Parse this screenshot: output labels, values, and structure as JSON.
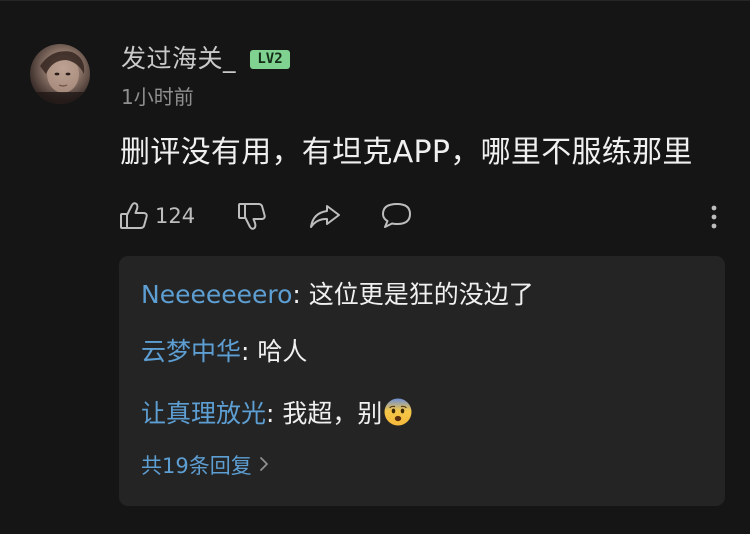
{
  "comment": {
    "username": "发过海关_",
    "level_badge": "LV2",
    "timestamp": "1小时前",
    "text": "删评没有用，有坦克APP，哪里不服练那里",
    "like_count": "124"
  },
  "icons": {
    "like": "thumbs-up-icon",
    "dislike": "thumbs-down-icon",
    "share": "share-icon",
    "reply": "comment-icon",
    "more": "more-vertical-icon",
    "chevron": "chevron-right-icon"
  },
  "replies": {
    "items": [
      {
        "author": "Neeeeeeero",
        "separator": ": ",
        "text": "这位更是狂的没边了"
      },
      {
        "author": "云梦中华",
        "separator": ": ",
        "text": "哈人"
      },
      {
        "author": "让真理放光",
        "separator": ": ",
        "text": "我超，别",
        "emoji": "fearful-face-emoji"
      }
    ],
    "view_all_label": "共19条回复"
  },
  "colors": {
    "background": "#151515",
    "panel": "#242424",
    "link_blue": "#5d9ed3",
    "level_green": "#7fd28f"
  }
}
